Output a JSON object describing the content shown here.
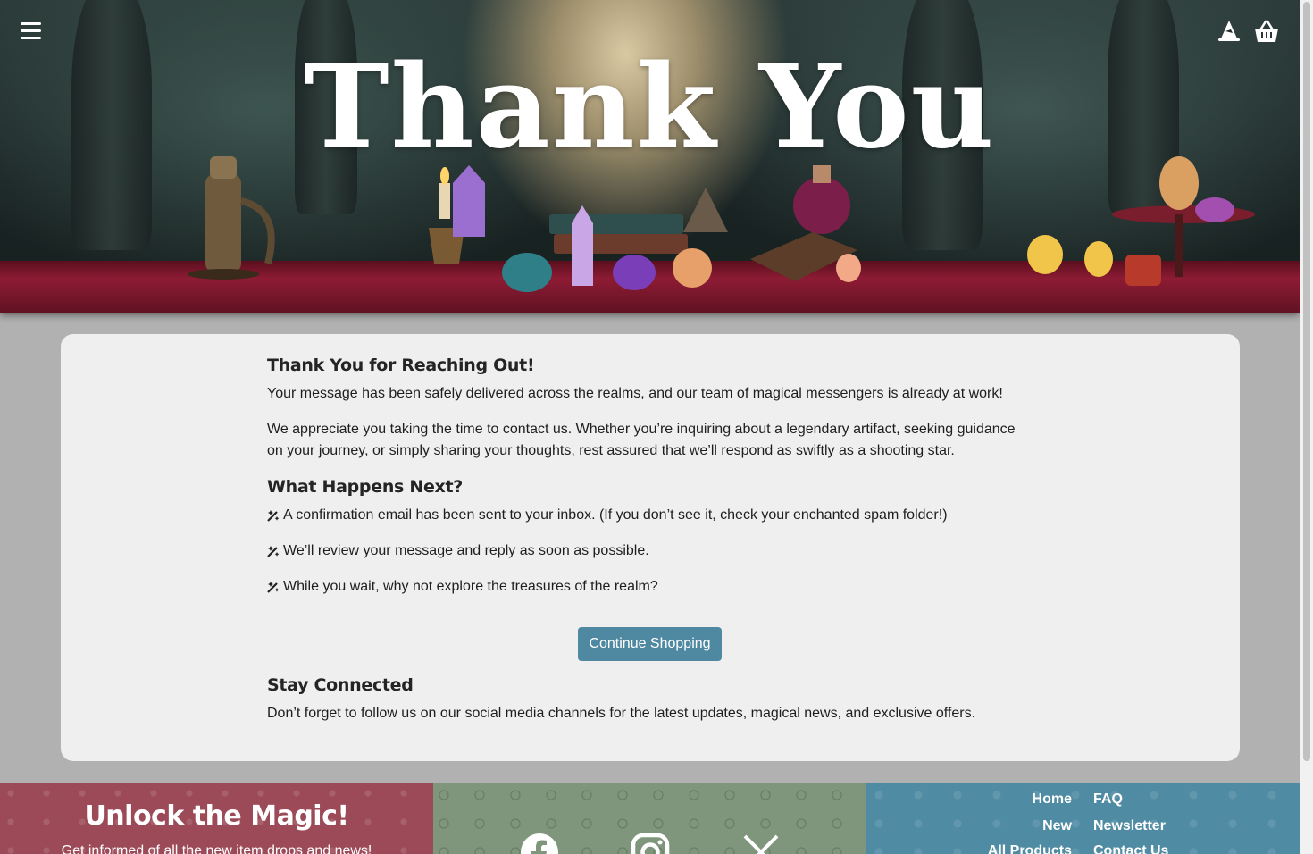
{
  "hero": {
    "title": "Thank You"
  },
  "header": {
    "menu_icon": "hamburger-menu-icon",
    "wizard_icon": "wizard-hat-icon",
    "cart_icon": "basket-icon"
  },
  "main": {
    "heading1": "Thank You for Reaching Out!",
    "para1": "Your message has been safely delivered across the realms, and our team of magical messengers is already at work!",
    "para2": "We appreciate you taking the time to contact us. Whether you’re inquiring about a legendary artifact, seeking guidance on your journey, or simply sharing your thoughts, rest assured that we’ll respond as swiftly as a shooting star.",
    "heading2": "What Happens Next?",
    "steps": [
      "A confirmation email has been sent to your inbox. (If you don’t see it, check your enchanted spam folder!)",
      "We’ll review your message and reply as soon as possible.",
      "While you wait, why not explore the treasures of the realm?"
    ],
    "button": "Continue Shopping",
    "heading3": "Stay Connected",
    "para3": "Don’t forget to follow us on our social media channels for the latest updates, magical news, and exclusive offers."
  },
  "footer": {
    "signup_title": "Unlock the Magic!",
    "signup_sub": "Get informed of all the new item drops and news!",
    "social": [
      "facebook-icon",
      "instagram-icon",
      "x-icon"
    ],
    "nav_left": [
      "Home",
      "New",
      "All Products"
    ],
    "nav_right": [
      "FAQ",
      "Newsletter",
      "Contact Us"
    ],
    "colors": {
      "red": "#9c4a58",
      "green": "#7f967c",
      "blue": "#4f8ba3",
      "button": "#4f89a1"
    }
  }
}
